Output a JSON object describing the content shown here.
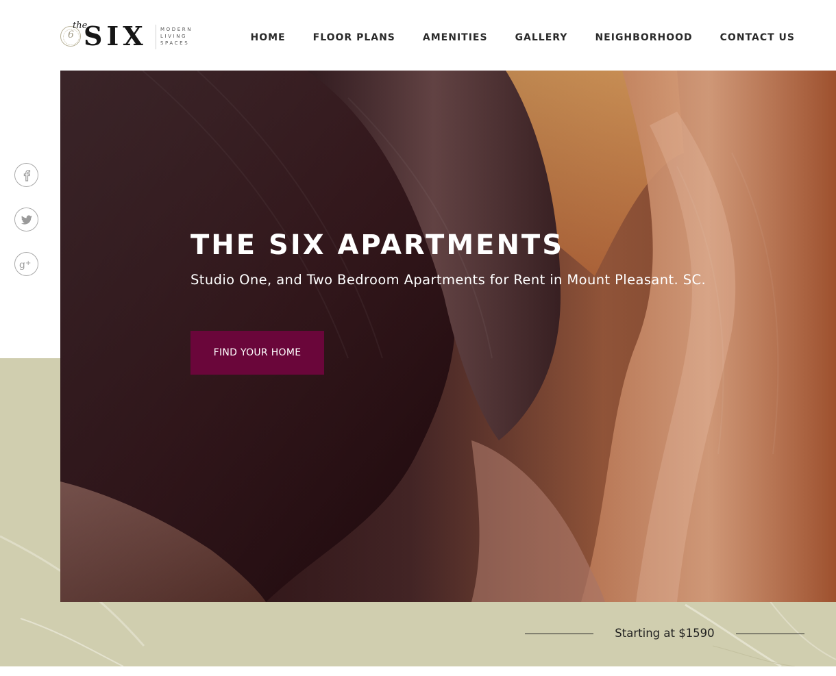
{
  "logo": {
    "the": "the",
    "numeral": "6",
    "name": "SIX",
    "tagline": [
      "MODERN",
      "LIVING",
      "SPACES"
    ]
  },
  "nav": {
    "items": [
      {
        "label": "HOME"
      },
      {
        "label": "FLOOR PLANS"
      },
      {
        "label": "AMENITIES"
      },
      {
        "label": "GALLERY"
      },
      {
        "label": "NEIGHBORHOOD"
      },
      {
        "label": "CONTACT US"
      }
    ]
  },
  "social": {
    "icons": [
      "facebook-icon",
      "twitter-icon",
      "google-plus-icon"
    ]
  },
  "hero": {
    "title": "THE SIX APARTMENTS",
    "subtitle": "Studio One, and Two Bedroom Apartments for Rent in Mount Pleasant. SC.",
    "cta_label": "FIND YOUR HOME"
  },
  "pricing": {
    "text": "Starting at $1590"
  },
  "colors": {
    "accent": "#6a063a",
    "beige": "#d0ceaf",
    "text": "#2a2a2a"
  }
}
